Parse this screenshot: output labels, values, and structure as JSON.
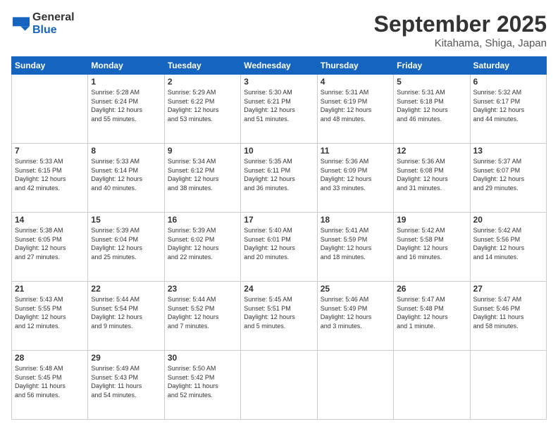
{
  "header": {
    "logo_general": "General",
    "logo_blue": "Blue",
    "month": "September 2025",
    "location": "Kitahama, Shiga, Japan"
  },
  "weekdays": [
    "Sunday",
    "Monday",
    "Tuesday",
    "Wednesday",
    "Thursday",
    "Friday",
    "Saturday"
  ],
  "weeks": [
    [
      {
        "day": "",
        "info": ""
      },
      {
        "day": "1",
        "info": "Sunrise: 5:28 AM\nSunset: 6:24 PM\nDaylight: 12 hours\nand 55 minutes."
      },
      {
        "day": "2",
        "info": "Sunrise: 5:29 AM\nSunset: 6:22 PM\nDaylight: 12 hours\nand 53 minutes."
      },
      {
        "day": "3",
        "info": "Sunrise: 5:30 AM\nSunset: 6:21 PM\nDaylight: 12 hours\nand 51 minutes."
      },
      {
        "day": "4",
        "info": "Sunrise: 5:31 AM\nSunset: 6:19 PM\nDaylight: 12 hours\nand 48 minutes."
      },
      {
        "day": "5",
        "info": "Sunrise: 5:31 AM\nSunset: 6:18 PM\nDaylight: 12 hours\nand 46 minutes."
      },
      {
        "day": "6",
        "info": "Sunrise: 5:32 AM\nSunset: 6:17 PM\nDaylight: 12 hours\nand 44 minutes."
      }
    ],
    [
      {
        "day": "7",
        "info": "Sunrise: 5:33 AM\nSunset: 6:15 PM\nDaylight: 12 hours\nand 42 minutes."
      },
      {
        "day": "8",
        "info": "Sunrise: 5:33 AM\nSunset: 6:14 PM\nDaylight: 12 hours\nand 40 minutes."
      },
      {
        "day": "9",
        "info": "Sunrise: 5:34 AM\nSunset: 6:12 PM\nDaylight: 12 hours\nand 38 minutes."
      },
      {
        "day": "10",
        "info": "Sunrise: 5:35 AM\nSunset: 6:11 PM\nDaylight: 12 hours\nand 36 minutes."
      },
      {
        "day": "11",
        "info": "Sunrise: 5:36 AM\nSunset: 6:09 PM\nDaylight: 12 hours\nand 33 minutes."
      },
      {
        "day": "12",
        "info": "Sunrise: 5:36 AM\nSunset: 6:08 PM\nDaylight: 12 hours\nand 31 minutes."
      },
      {
        "day": "13",
        "info": "Sunrise: 5:37 AM\nSunset: 6:07 PM\nDaylight: 12 hours\nand 29 minutes."
      }
    ],
    [
      {
        "day": "14",
        "info": "Sunrise: 5:38 AM\nSunset: 6:05 PM\nDaylight: 12 hours\nand 27 minutes."
      },
      {
        "day": "15",
        "info": "Sunrise: 5:39 AM\nSunset: 6:04 PM\nDaylight: 12 hours\nand 25 minutes."
      },
      {
        "day": "16",
        "info": "Sunrise: 5:39 AM\nSunset: 6:02 PM\nDaylight: 12 hours\nand 22 minutes."
      },
      {
        "day": "17",
        "info": "Sunrise: 5:40 AM\nSunset: 6:01 PM\nDaylight: 12 hours\nand 20 minutes."
      },
      {
        "day": "18",
        "info": "Sunrise: 5:41 AM\nSunset: 5:59 PM\nDaylight: 12 hours\nand 18 minutes."
      },
      {
        "day": "19",
        "info": "Sunrise: 5:42 AM\nSunset: 5:58 PM\nDaylight: 12 hours\nand 16 minutes."
      },
      {
        "day": "20",
        "info": "Sunrise: 5:42 AM\nSunset: 5:56 PM\nDaylight: 12 hours\nand 14 minutes."
      }
    ],
    [
      {
        "day": "21",
        "info": "Sunrise: 5:43 AM\nSunset: 5:55 PM\nDaylight: 12 hours\nand 12 minutes."
      },
      {
        "day": "22",
        "info": "Sunrise: 5:44 AM\nSunset: 5:54 PM\nDaylight: 12 hours\nand 9 minutes."
      },
      {
        "day": "23",
        "info": "Sunrise: 5:44 AM\nSunset: 5:52 PM\nDaylight: 12 hours\nand 7 minutes."
      },
      {
        "day": "24",
        "info": "Sunrise: 5:45 AM\nSunset: 5:51 PM\nDaylight: 12 hours\nand 5 minutes."
      },
      {
        "day": "25",
        "info": "Sunrise: 5:46 AM\nSunset: 5:49 PM\nDaylight: 12 hours\nand 3 minutes."
      },
      {
        "day": "26",
        "info": "Sunrise: 5:47 AM\nSunset: 5:48 PM\nDaylight: 12 hours\nand 1 minute."
      },
      {
        "day": "27",
        "info": "Sunrise: 5:47 AM\nSunset: 5:46 PM\nDaylight: 11 hours\nand 58 minutes."
      }
    ],
    [
      {
        "day": "28",
        "info": "Sunrise: 5:48 AM\nSunset: 5:45 PM\nDaylight: 11 hours\nand 56 minutes."
      },
      {
        "day": "29",
        "info": "Sunrise: 5:49 AM\nSunset: 5:43 PM\nDaylight: 11 hours\nand 54 minutes."
      },
      {
        "day": "30",
        "info": "Sunrise: 5:50 AM\nSunset: 5:42 PM\nDaylight: 11 hours\nand 52 minutes."
      },
      {
        "day": "",
        "info": ""
      },
      {
        "day": "",
        "info": ""
      },
      {
        "day": "",
        "info": ""
      },
      {
        "day": "",
        "info": ""
      }
    ]
  ]
}
